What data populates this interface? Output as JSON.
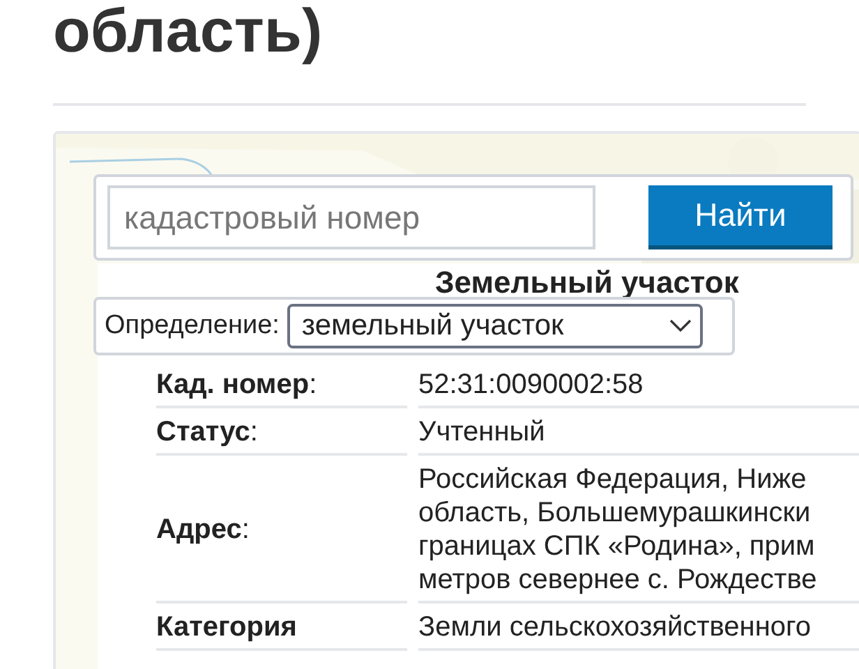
{
  "page_title": "область)",
  "search": {
    "placeholder": "кадастровый номер",
    "button": "Найти"
  },
  "heading": "Земельный участок",
  "definition": {
    "label": "Определение:",
    "value": "земельный участок"
  },
  "rows": [
    {
      "label": "**Кад. номер**:",
      "value": [
        "52:31:0090002:58"
      ]
    },
    {
      "label": "**Статус**:",
      "value": [
        "Учтенный"
      ]
    },
    {
      "label": "**Адрес**:",
      "value": [
        "Российская Федерация, Ниже",
        "область, Большемурашкински",
        "границах СПК «Родина», прим",
        "метров севернее с. Рождестве"
      ]
    },
    {
      "label": "**Категория**",
      "value": [
        "Земли сельскохозяйственного"
      ]
    }
  ]
}
